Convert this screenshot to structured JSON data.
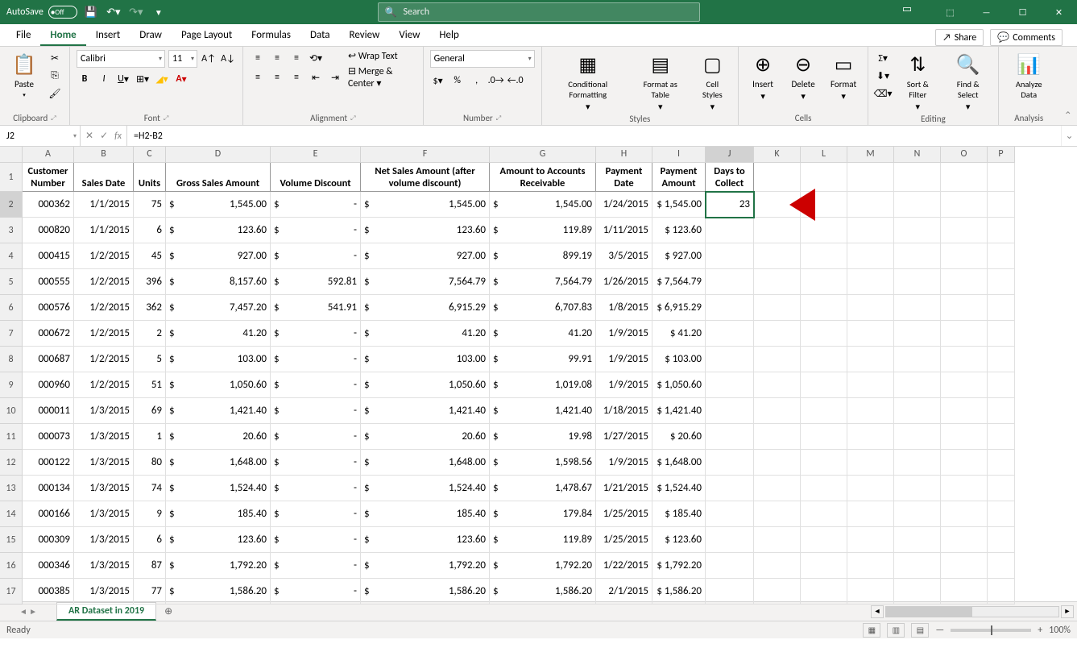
{
  "titlebar": {
    "autosave_label": "AutoSave",
    "autosave_state": "Off",
    "search_placeholder": "Search"
  },
  "ribbon_tabs": [
    "File",
    "Home",
    "Insert",
    "Draw",
    "Page Layout",
    "Formulas",
    "Data",
    "Review",
    "View",
    "Help"
  ],
  "active_tab": "Home",
  "share_label": "Share",
  "comments_label": "Comments",
  "ribbon": {
    "clipboard": {
      "paste": "Paste",
      "label": "Clipboard"
    },
    "font": {
      "name": "Calibri",
      "size": "11",
      "label": "Font"
    },
    "alignment": {
      "wrap": "Wrap Text",
      "merge": "Merge & Center",
      "label": "Alignment"
    },
    "number": {
      "format": "General",
      "label": "Number"
    },
    "styles": {
      "cond": "Conditional Formatting",
      "table": "Format as Table",
      "cell": "Cell Styles",
      "label": "Styles"
    },
    "cells": {
      "insert": "Insert",
      "delete": "Delete",
      "format": "Format",
      "label": "Cells"
    },
    "editing": {
      "sort": "Sort & Filter",
      "find": "Find & Select",
      "label": "Editing"
    },
    "analysis": {
      "analyze": "Analyze Data",
      "label": "Analysis"
    }
  },
  "namebox": "J2",
  "formula": "=H2-B2",
  "columns": [
    "A",
    "B",
    "C",
    "D",
    "E",
    "F",
    "G",
    "H",
    "I",
    "J",
    "K",
    "L",
    "M",
    "N",
    "O",
    "P"
  ],
  "sel_col": "J",
  "sel_row": "2",
  "headers": [
    "Customer Number",
    "Sales Date",
    "Units",
    "Gross Sales Amount",
    "Volume Discount",
    "Net Sales Amount (after volume discount)",
    "Amount to Accounts Receivable",
    "Payment Date",
    "Payment Amount",
    "Days to Collect"
  ],
  "rows": [
    {
      "n": "000362",
      "sd": "1/1/2015",
      "u": "75",
      "gs": "1,545.00",
      "vd": "-",
      "ns": "1,545.00",
      "ar": "1,545.00",
      "pd": "1/24/2015",
      "pa": "$ 1,545.00",
      "dc": "23"
    },
    {
      "n": "000820",
      "sd": "1/1/2015",
      "u": "6",
      "gs": "123.60",
      "vd": "-",
      "ns": "123.60",
      "ar": "119.89",
      "pd": "1/11/2015",
      "pa": "$   123.60",
      "dc": ""
    },
    {
      "n": "000415",
      "sd": "1/2/2015",
      "u": "45",
      "gs": "927.00",
      "vd": "-",
      "ns": "927.00",
      "ar": "899.19",
      "pd": "3/5/2015",
      "pa": "$   927.00",
      "dc": ""
    },
    {
      "n": "000555",
      "sd": "1/2/2015",
      "u": "396",
      "gs": "8,157.60",
      "vd": "592.81",
      "ns": "7,564.79",
      "ar": "7,564.79",
      "pd": "1/26/2015",
      "pa": "$ 7,564.79",
      "dc": ""
    },
    {
      "n": "000576",
      "sd": "1/2/2015",
      "u": "362",
      "gs": "7,457.20",
      "vd": "541.91",
      "ns": "6,915.29",
      "ar": "6,707.83",
      "pd": "1/8/2015",
      "pa": "$ 6,915.29",
      "dc": ""
    },
    {
      "n": "000672",
      "sd": "1/2/2015",
      "u": "2",
      "gs": "41.20",
      "vd": "-",
      "ns": "41.20",
      "ar": "41.20",
      "pd": "1/9/2015",
      "pa": "$     41.20",
      "dc": ""
    },
    {
      "n": "000687",
      "sd": "1/2/2015",
      "u": "5",
      "gs": "103.00",
      "vd": "-",
      "ns": "103.00",
      "ar": "99.91",
      "pd": "1/9/2015",
      "pa": "$   103.00",
      "dc": ""
    },
    {
      "n": "000960",
      "sd": "1/2/2015",
      "u": "51",
      "gs": "1,050.60",
      "vd": "-",
      "ns": "1,050.60",
      "ar": "1,019.08",
      "pd": "1/9/2015",
      "pa": "$ 1,050.60",
      "dc": ""
    },
    {
      "n": "000011",
      "sd": "1/3/2015",
      "u": "69",
      "gs": "1,421.40",
      "vd": "-",
      "ns": "1,421.40",
      "ar": "1,421.40",
      "pd": "1/18/2015",
      "pa": "$ 1,421.40",
      "dc": ""
    },
    {
      "n": "000073",
      "sd": "1/3/2015",
      "u": "1",
      "gs": "20.60",
      "vd": "-",
      "ns": "20.60",
      "ar": "19.98",
      "pd": "1/27/2015",
      "pa": "$     20.60",
      "dc": ""
    },
    {
      "n": "000122",
      "sd": "1/3/2015",
      "u": "80",
      "gs": "1,648.00",
      "vd": "-",
      "ns": "1,648.00",
      "ar": "1,598.56",
      "pd": "1/9/2015",
      "pa": "$ 1,648.00",
      "dc": ""
    },
    {
      "n": "000134",
      "sd": "1/3/2015",
      "u": "74",
      "gs": "1,524.40",
      "vd": "-",
      "ns": "1,524.40",
      "ar": "1,478.67",
      "pd": "1/21/2015",
      "pa": "$ 1,524.40",
      "dc": ""
    },
    {
      "n": "000166",
      "sd": "1/3/2015",
      "u": "9",
      "gs": "185.40",
      "vd": "-",
      "ns": "185.40",
      "ar": "179.84",
      "pd": "1/25/2015",
      "pa": "$   185.40",
      "dc": ""
    },
    {
      "n": "000309",
      "sd": "1/3/2015",
      "u": "6",
      "gs": "123.60",
      "vd": "-",
      "ns": "123.60",
      "ar": "119.89",
      "pd": "1/25/2015",
      "pa": "$   123.60",
      "dc": ""
    },
    {
      "n": "000346",
      "sd": "1/3/2015",
      "u": "87",
      "gs": "1,792.20",
      "vd": "-",
      "ns": "1,792.20",
      "ar": "1,792.20",
      "pd": "1/22/2015",
      "pa": "$ 1,792.20",
      "dc": ""
    },
    {
      "n": "000385",
      "sd": "1/3/2015",
      "u": "77",
      "gs": "1,586.20",
      "vd": "-",
      "ns": "1,586.20",
      "ar": "1,586.20",
      "pd": "2/1/2015",
      "pa": "$ 1,586.20",
      "dc": ""
    }
  ],
  "sheet_tab": "AR Dataset in 2019",
  "status": "Ready",
  "zoom": "100%"
}
